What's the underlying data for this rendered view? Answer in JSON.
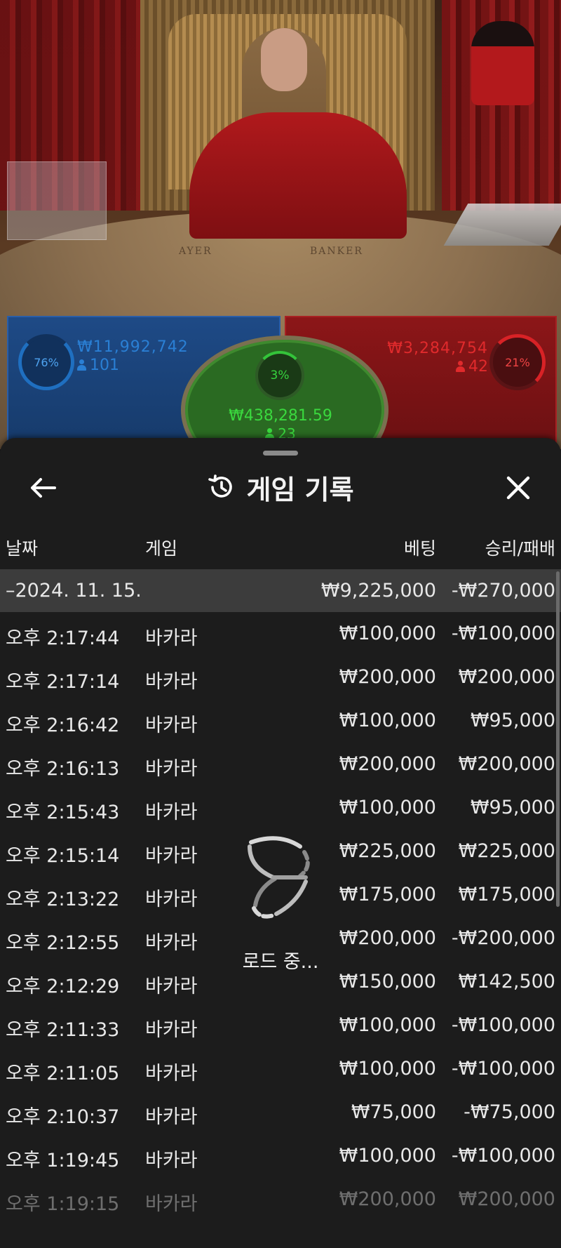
{
  "betting": {
    "player": {
      "percent": "76%",
      "amount": "₩11,992,742",
      "players": "101",
      "color": "#1f6fc0"
    },
    "tie": {
      "percent": "3%",
      "amount": "₩438,281.59",
      "players": "23",
      "color": "#36d43e"
    },
    "banker": {
      "percent": "21%",
      "amount": "₩3,284,754",
      "players": "42",
      "color": "#d82226"
    }
  },
  "table_labels": {
    "player": "AYER",
    "banker": "BANKER"
  },
  "sheet": {
    "title": "게임 기록",
    "back_icon": "arrow-left-icon",
    "close_icon": "close-icon",
    "history_icon": "history-icon",
    "columns": {
      "date": "날짜",
      "game": "게임",
      "bet": "베팅",
      "result": "승리/패배"
    },
    "summary": {
      "date": "–2024. 11. 15.",
      "bet": "₩9,225,000",
      "result": "-₩270,000"
    },
    "rows": [
      {
        "time": "오후 2:17:44",
        "game": "바카라",
        "bet": "₩100,000",
        "result": "-₩100,000"
      },
      {
        "time": "오후 2:17:14",
        "game": "바카라",
        "bet": "₩200,000",
        "result": "₩200,000"
      },
      {
        "time": "오후 2:16:42",
        "game": "바카라",
        "bet": "₩100,000",
        "result": "₩95,000"
      },
      {
        "time": "오후 2:16:13",
        "game": "바카라",
        "bet": "₩200,000",
        "result": "₩200,000"
      },
      {
        "time": "오후 2:15:43",
        "game": "바카라",
        "bet": "₩100,000",
        "result": "₩95,000"
      },
      {
        "time": "오후 2:15:14",
        "game": "바카라",
        "bet": "₩225,000",
        "result": "₩225,000"
      },
      {
        "time": "오후 2:13:22",
        "game": "바카라",
        "bet": "₩175,000",
        "result": "₩175,000"
      },
      {
        "time": "오후 2:12:55",
        "game": "바카라",
        "bet": "₩200,000",
        "result": "-₩200,000"
      },
      {
        "time": "오후 2:12:29",
        "game": "바카라",
        "bet": "₩150,000",
        "result": "₩142,500"
      },
      {
        "time": "오후 2:11:33",
        "game": "바카라",
        "bet": "₩100,000",
        "result": "-₩100,000"
      },
      {
        "time": "오후 2:11:05",
        "game": "바카라",
        "bet": "₩100,000",
        "result": "-₩100,000"
      },
      {
        "time": "오후 2:10:37",
        "game": "바카라",
        "bet": "₩75,000",
        "result": "-₩75,000"
      },
      {
        "time": "오후 1:19:45",
        "game": "바카라",
        "bet": "₩100,000",
        "result": "-₩100,000"
      },
      {
        "time": "오후 1:19:15",
        "game": "바카라",
        "bet": "₩200,000",
        "result": "₩200,000"
      }
    ],
    "loading_text": "로드 중..."
  }
}
